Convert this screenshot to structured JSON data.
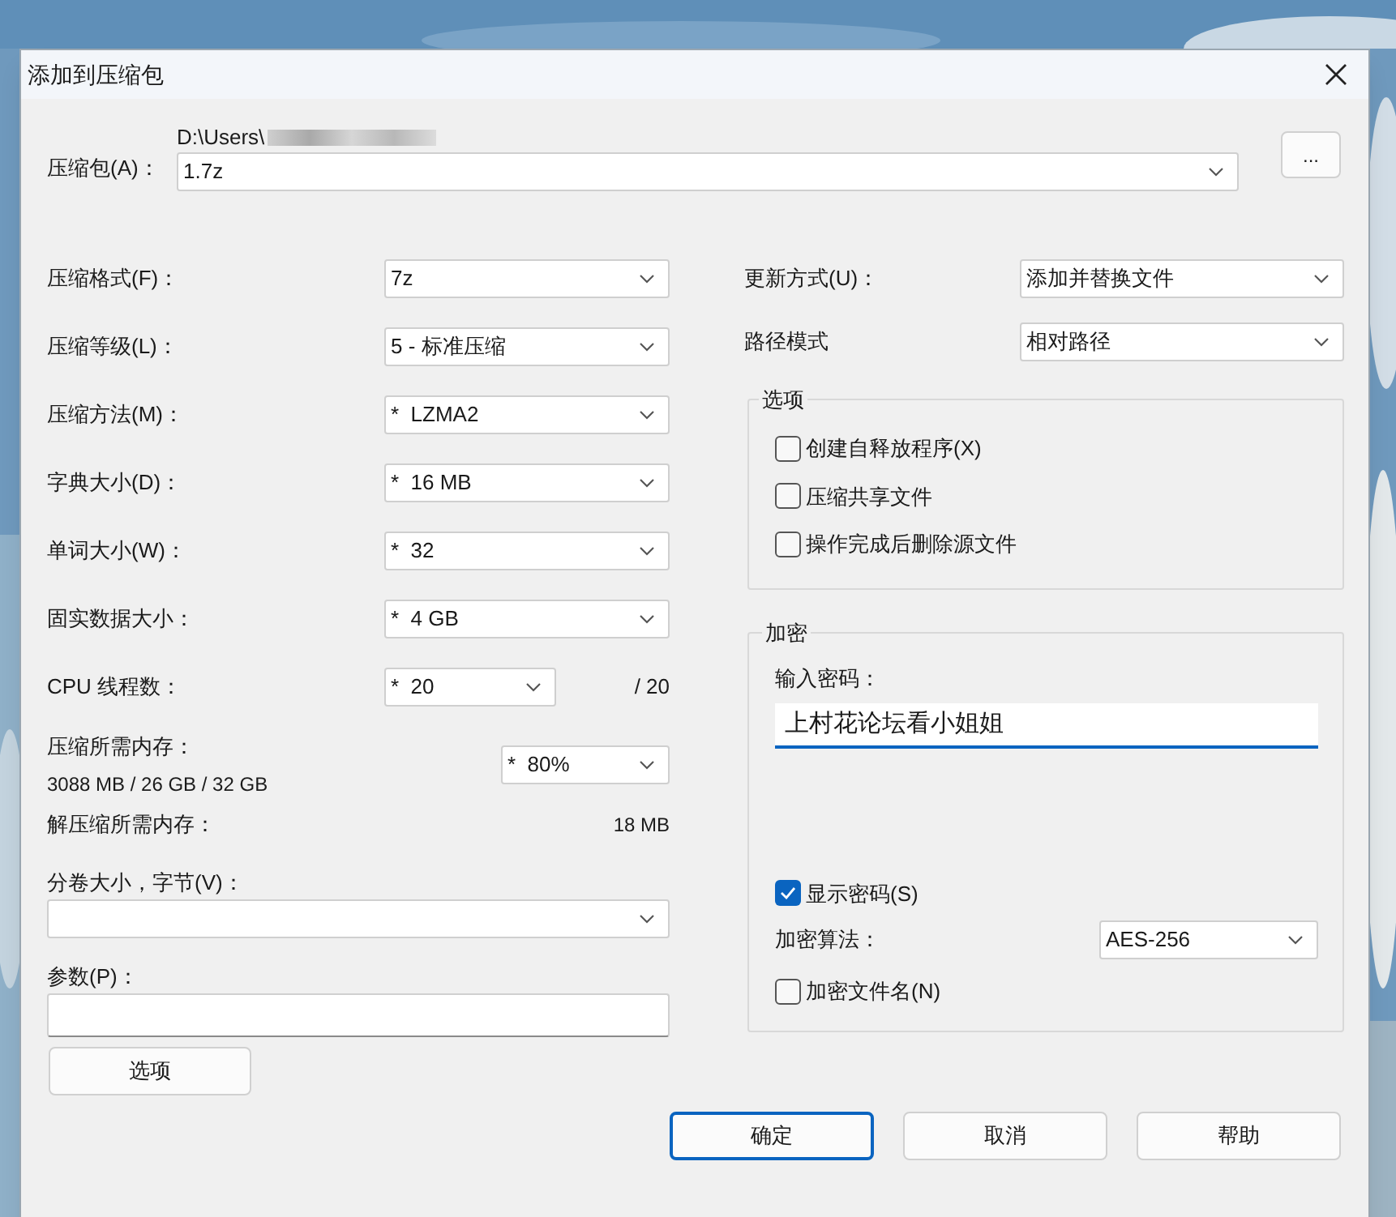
{
  "window": {
    "title": "添加到压缩包"
  },
  "archive": {
    "label": "压缩包(A)：",
    "path": "D:\\Users\\",
    "value": "1.7z",
    "browse_button": "..."
  },
  "left_fields": [
    {
      "kind": "combo",
      "label": "压缩格式(F)：",
      "value": "7z"
    },
    {
      "kind": "combo",
      "label": "压缩等级(L)：",
      "value": "5 - 标准压缩"
    },
    {
      "kind": "combo",
      "label": "压缩方法(M)：",
      "value": "*  LZMA2"
    },
    {
      "kind": "combo",
      "label": "字典大小(D)：",
      "value": "*  16 MB"
    },
    {
      "kind": "combo",
      "label": "单词大小(W)：",
      "value": "*  32"
    },
    {
      "kind": "combo",
      "label": "固实数据大小：",
      "value": "*  4 GB"
    },
    {
      "kind": "threads",
      "label": "CPU 线程数：",
      "value": "*  20",
      "suffix": "/ 20"
    }
  ],
  "memory": {
    "label": "压缩所需内存：",
    "detail": "3088 MB / 26 GB / 32 GB",
    "value": "*  80%"
  },
  "decompress_memory": {
    "label": "解压缩所需内存：",
    "value": "18 MB"
  },
  "split": {
    "label": "分卷大小，字节(V)："
  },
  "parameters": {
    "label": "参数(P)："
  },
  "options_button": "选项",
  "update_mode": {
    "label": "更新方式(U)：",
    "value": "添加并替换文件"
  },
  "path_mode": {
    "label": "路径模式",
    "value": "相对路径"
  },
  "options_group": {
    "title": "选项",
    "items": [
      {
        "label": "创建自释放程序(X)",
        "checked": false
      },
      {
        "label": "压缩共享文件",
        "checked": false
      },
      {
        "label": "操作完成后删除源文件",
        "checked": false
      }
    ]
  },
  "encryption": {
    "title": "加密",
    "password_label": "输入密码：",
    "password": "上村花论坛看小姐姐",
    "show_password": {
      "label": "显示密码(S)",
      "checked": true
    },
    "method_label": "加密算法：",
    "method": "AES-256",
    "encrypt_names": {
      "label": "加密文件名(N)",
      "checked": false
    }
  },
  "buttons": [
    "确定",
    "取消",
    "帮助"
  ]
}
